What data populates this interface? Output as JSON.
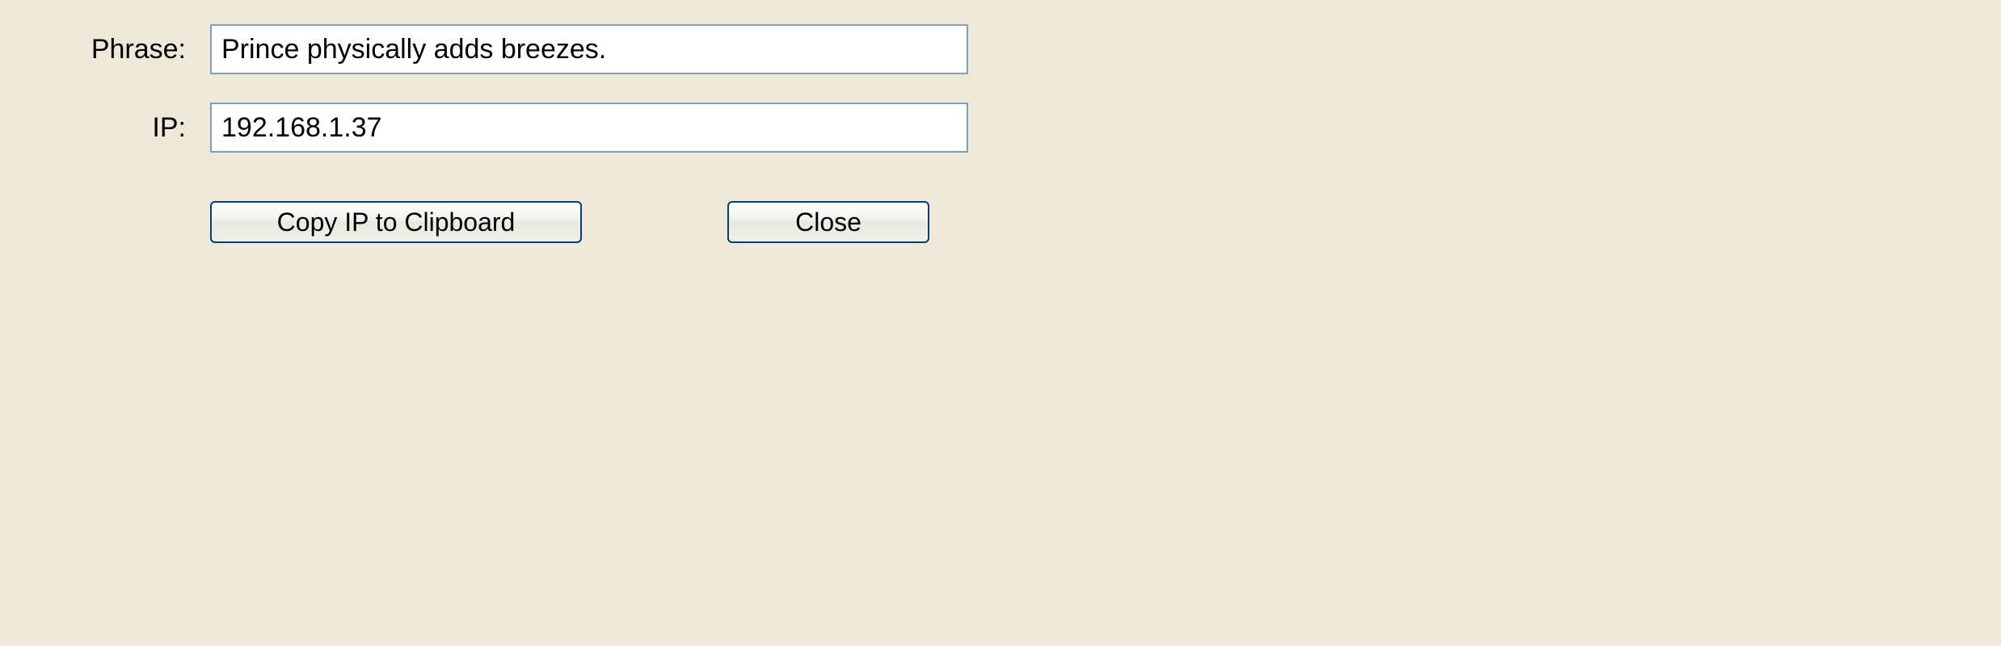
{
  "form": {
    "phrase_label": "Phrase:",
    "phrase_value": "Prince physically adds breezes.",
    "ip_label": "IP:",
    "ip_value": "192.168.1.37"
  },
  "buttons": {
    "copy_label": "Copy IP to Clipboard",
    "close_label": "Close"
  }
}
